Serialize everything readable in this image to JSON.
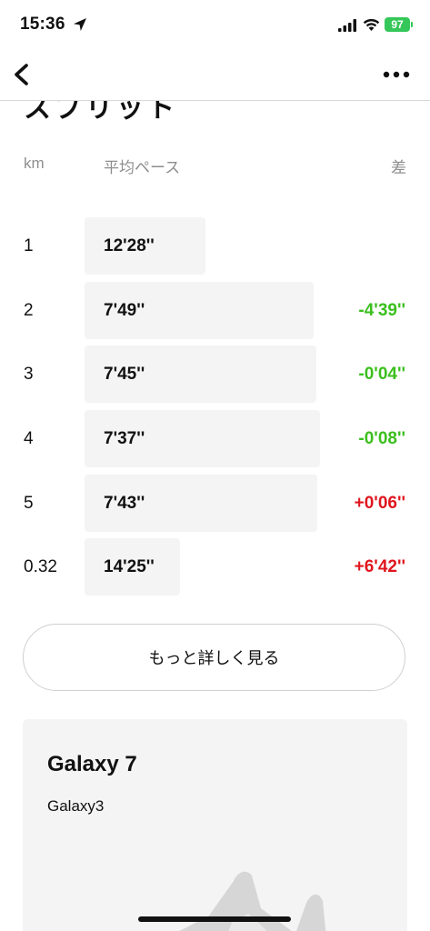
{
  "status_bar": {
    "time": "15:36",
    "battery_level": "97",
    "icons": [
      "location-arrow-icon",
      "cellular-signal-icon",
      "wifi-icon",
      "battery-icon"
    ]
  },
  "nav": {
    "back_icon": "chevron-left-icon",
    "more_icon": "ellipsis-icon",
    "partial_title": "スプリット"
  },
  "table": {
    "headers": {
      "km": "km",
      "pace": "平均ペース",
      "diff": "差"
    },
    "rows": [
      {
        "km": "1",
        "pace": "12'28''",
        "diff": "",
        "fill_fraction": 0.386
      },
      {
        "km": "2",
        "pace": "7'49''",
        "diff": "-4'39''",
        "diff_color": "#3bbf1d",
        "fill_fraction": 0.732
      },
      {
        "km": "3",
        "pace": "7'45''",
        "diff": "-0'04''",
        "diff_color": "#3bbf1d",
        "fill_fraction": 0.741
      },
      {
        "km": "4",
        "pace": "7'37''",
        "diff": "-0'08''",
        "diff_color": "#3bbf1d",
        "fill_fraction": 0.754
      },
      {
        "km": "5",
        "pace": "7'43''",
        "diff": "+0'06''",
        "diff_color": "#e0161e",
        "fill_fraction": 0.745
      },
      {
        "km": "0.32",
        "pace": "14'25''",
        "diff": "+6'42''",
        "diff_color": "#e0161e",
        "fill_fraction": 0.305
      }
    ]
  },
  "more_details_label": "もっと詳しく見る",
  "shoe": {
    "name": "Galaxy 7",
    "subtitle": "Galaxy3"
  },
  "colors": {
    "negative_diff": "#3bbf1d",
    "positive_diff": "#e0161e",
    "battery": "#35c759"
  }
}
